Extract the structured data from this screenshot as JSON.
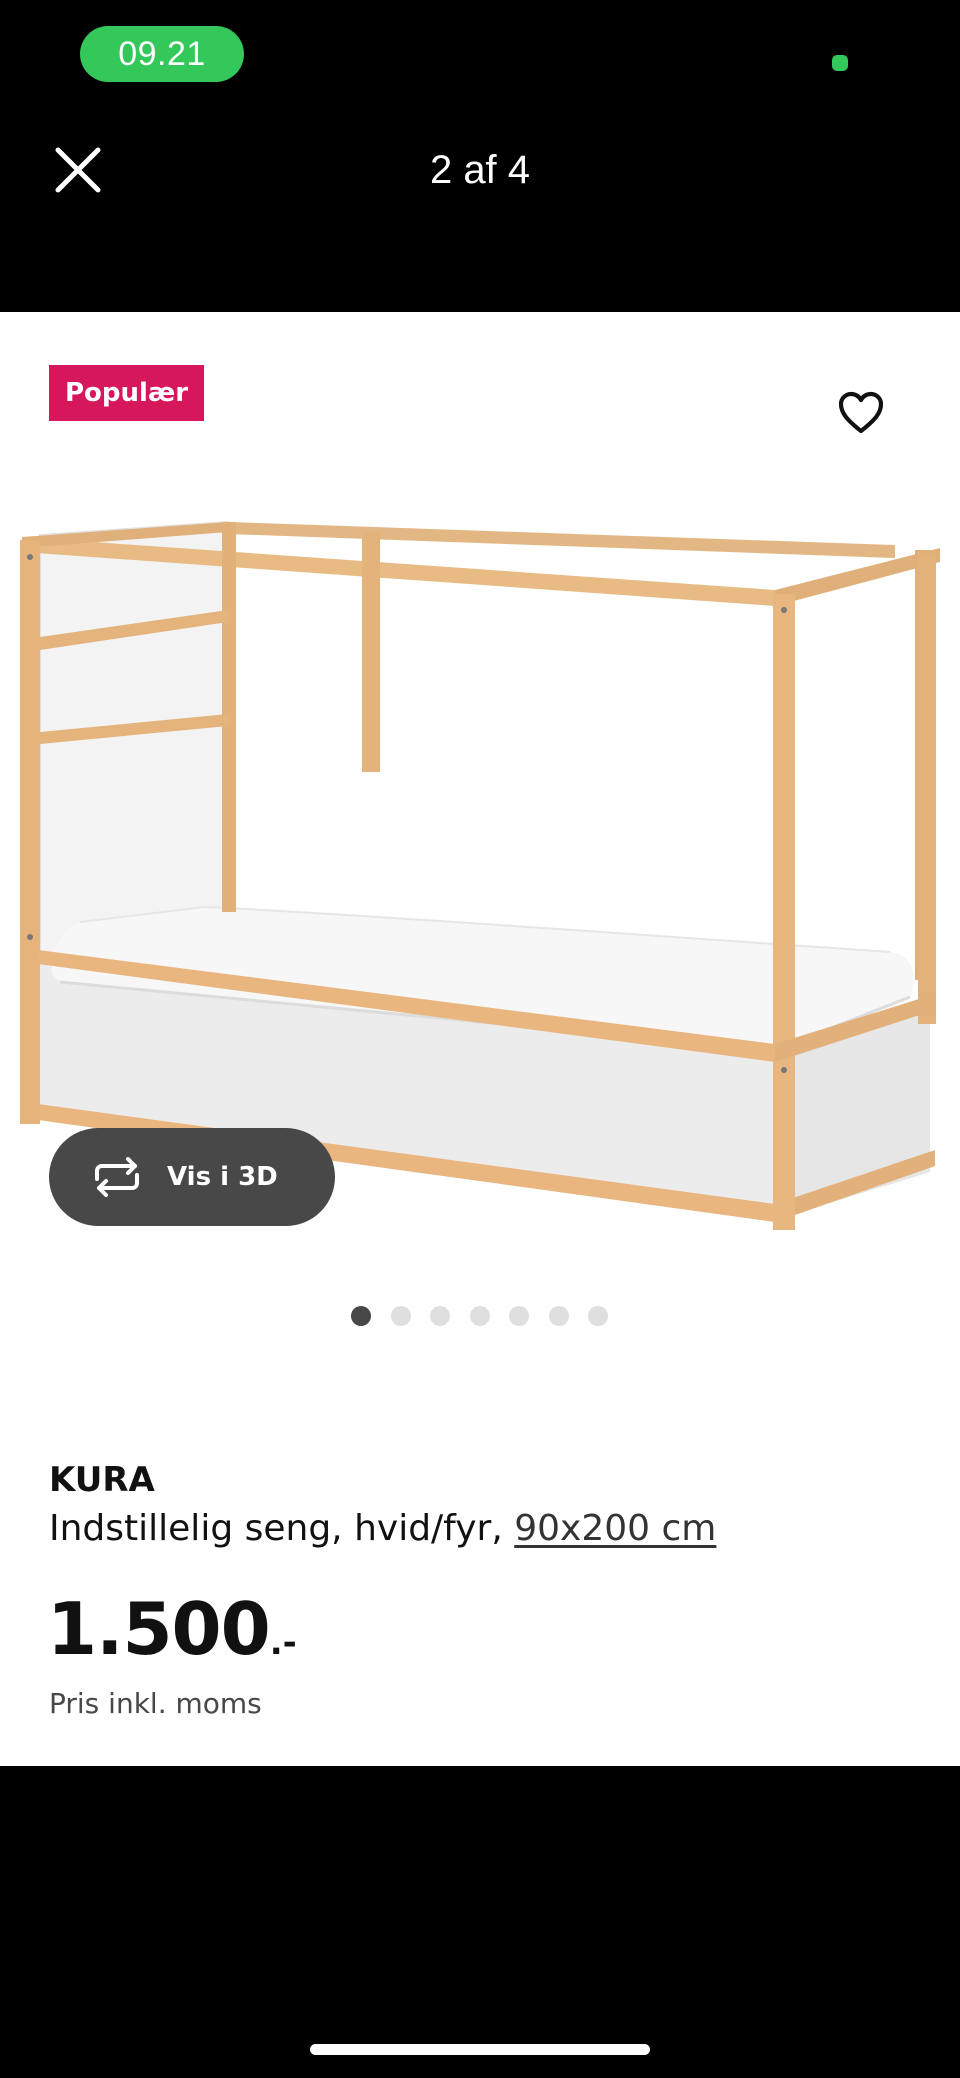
{
  "status_bar": {
    "time": "09.21"
  },
  "header": {
    "close_icon": "close-icon",
    "title": "2 af 4"
  },
  "product": {
    "badge": "Populær",
    "favorite_icon": "heart-outline-icon",
    "view_3d": {
      "icon": "rotate-3d-icon",
      "label": "Vis i 3D"
    },
    "carousel": {
      "total": 7,
      "active_index": 0
    },
    "name": "KURA",
    "description": "Indstillelig seng, hvid/fyr, ",
    "size_link": "90x200 cm",
    "price_main": "1.500",
    "price_suffix": ".-",
    "price_note": "Pris inkl. moms"
  },
  "colors": {
    "status_green": "#34c759",
    "badge_red": "#d6175c",
    "button_dark": "#484848"
  }
}
